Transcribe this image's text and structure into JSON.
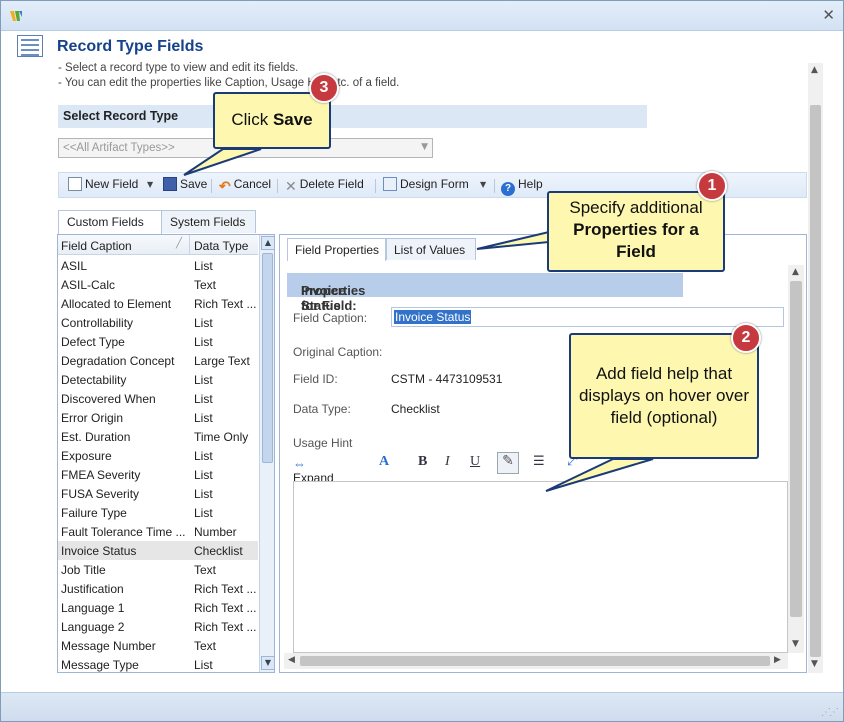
{
  "page": {
    "title": "Record Type Fields",
    "instructions": [
      "-   Select a record type to view and edit its fields.",
      "-   You can edit the properties like Caption, Usage Hint etc. of a field."
    ]
  },
  "select_record_type": {
    "heading": "Select Record Type",
    "combo_value": "<<All Artifact Types>>"
  },
  "toolbar": {
    "new_field": "New Field",
    "save": "Save",
    "cancel": "Cancel",
    "delete_field": "Delete Field",
    "design_form": "Design Form",
    "help": "Help"
  },
  "left_tabs": [
    "Custom Fields",
    "System Fields"
  ],
  "field_list": {
    "columns": [
      "Field Caption",
      "Data Type"
    ],
    "rows": [
      {
        "caption": "ASIL",
        "type": "List"
      },
      {
        "caption": "ASIL-Calc",
        "type": "Text"
      },
      {
        "caption": "Allocated to Element",
        "type": "Rich Text ..."
      },
      {
        "caption": "Controllability",
        "type": "List"
      },
      {
        "caption": "Defect Type",
        "type": "List"
      },
      {
        "caption": "Degradation Concept",
        "type": "Large Text"
      },
      {
        "caption": "Detectability",
        "type": "List"
      },
      {
        "caption": "Discovered When",
        "type": "List"
      },
      {
        "caption": "Error Origin",
        "type": "List"
      },
      {
        "caption": "Est. Duration",
        "type": "Time Only"
      },
      {
        "caption": "Exposure",
        "type": "List"
      },
      {
        "caption": "FMEA Severity",
        "type": "List"
      },
      {
        "caption": "FUSA Severity",
        "type": "List"
      },
      {
        "caption": "Failure Type",
        "type": "List"
      },
      {
        "caption": "Fault Tolerance Time ...",
        "type": "Number"
      },
      {
        "caption": "Invoice Status",
        "type": "Checklist"
      },
      {
        "caption": "Job Title",
        "type": "Text"
      },
      {
        "caption": "Justification",
        "type": "Rich Text ..."
      },
      {
        "caption": "Language 1",
        "type": "Rich Text ..."
      },
      {
        "caption": "Language 2",
        "type": "Rich Text ..."
      },
      {
        "caption": "Message Number",
        "type": "Text"
      },
      {
        "caption": "Message Type",
        "type": "List"
      }
    ],
    "selected_index": 15
  },
  "right_tabs": [
    "Field Properties",
    "List of Values"
  ],
  "properties": {
    "header_prefix": "Properties for Field:",
    "header_field": "Invoice Status",
    "field_caption_label": "Field Caption:",
    "field_caption_value": "Invoice Status",
    "original_caption_label": "Original Caption:",
    "field_id_label": "Field ID:",
    "field_id_value": "CSTM - 4473109531",
    "data_type_label": "Data Type:",
    "data_type_value": "Checklist",
    "usage_hint_label": "Usage Hint",
    "editor_expand": "Expand"
  },
  "callouts": {
    "c1": {
      "badge": "1",
      "line1": "Specify additional",
      "line2": "Properties for a",
      "line3": "Field"
    },
    "c2": {
      "badge": "2",
      "text": "Add field help that displays on hover over field (optional)"
    },
    "c3": {
      "badge": "3",
      "prefix": "Click",
      "bold": "Save"
    }
  },
  "colors": {
    "title_blue": "#15428b",
    "callout_fill": "#fdf7b0",
    "callout_border": "#1a3a78",
    "badge_red": "#c6393e",
    "selection_blue": "#3272c8"
  }
}
